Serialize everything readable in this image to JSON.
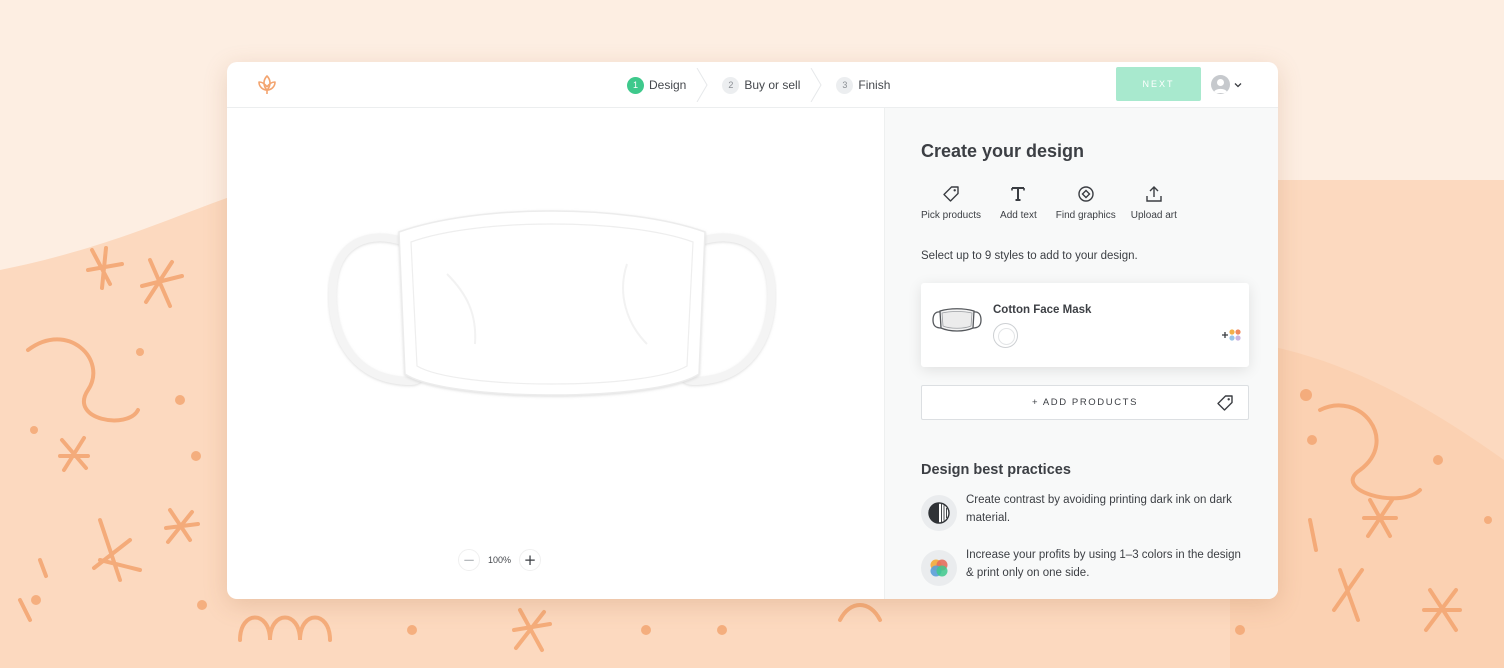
{
  "steps": [
    {
      "num": "1",
      "label": "Design"
    },
    {
      "num": "2",
      "label": "Buy or sell"
    },
    {
      "num": "3",
      "label": "Finish"
    }
  ],
  "header": {
    "next_label": "NEXT"
  },
  "canvas": {
    "zoom_level": "100%",
    "zoom_out": "−",
    "zoom_in": "+"
  },
  "panel": {
    "title": "Create your design",
    "tools": [
      {
        "label": "Pick products",
        "icon": "tag-icon"
      },
      {
        "label": "Add text",
        "icon": "text-icon"
      },
      {
        "label": "Find graphics",
        "icon": "graphics-icon"
      },
      {
        "label": "Upload art",
        "icon": "upload-icon"
      }
    ],
    "instruction": "Select up to 9 styles to add to your design.",
    "product": {
      "name": "Cotton Face Mask",
      "more_colors": "+"
    },
    "add_products_label": "+ ADD PRODUCTS",
    "best_practices": {
      "title": "Design best practices",
      "tips": [
        {
          "text": "Create contrast by avoiding printing dark ink on dark material.",
          "icon": "contrast-icon"
        },
        {
          "text": "Increase your profits by using 1–3 colors in the design & print only on one side.",
          "icon": "colors-icon"
        }
      ]
    }
  },
  "colors": {
    "accent": "#3ec98c",
    "next_disabled": "#a8e9ce",
    "brand_orange": "#f3a46f",
    "background": "#fde9da"
  }
}
